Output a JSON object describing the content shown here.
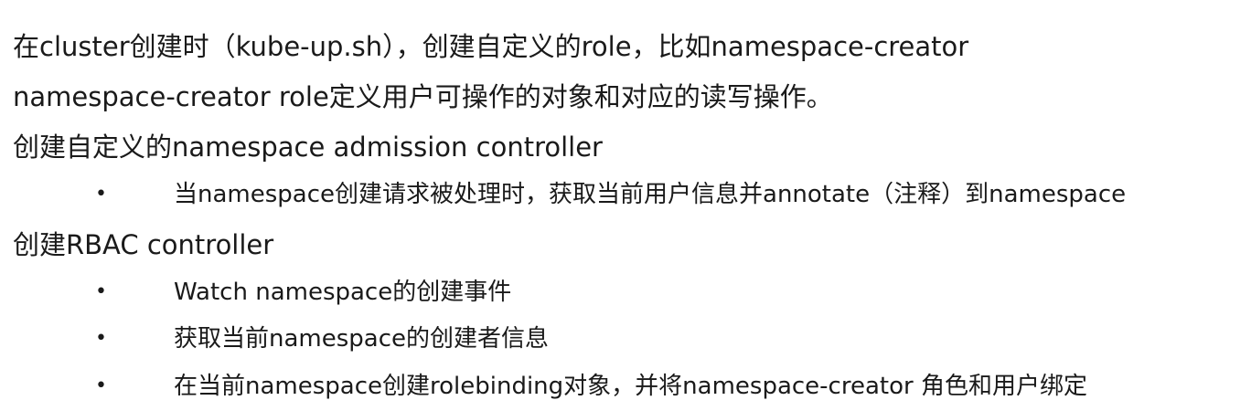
{
  "doc": {
    "line1": "在cluster创建时（kube-up.sh），创建自定义的role，比如namespace-creator",
    "line2": "namespace-creator role定义用户可操作的对象和对应的读写操作。",
    "line3": "创建自定义的namespace admission controller",
    "bullets_group1": [
      "当namespace创建请求被处理时，获取当前用户信息并annotate（注释）到namespace"
    ],
    "line4": "创建RBAC controller",
    "bullets_group2": [
      "Watch namespace的创建事件",
      "获取当前namespace的创建者信息",
      "在当前namespace创建rolebinding对象，并将namespace-creator 角色和用户绑定"
    ],
    "bullet_symbol": "•"
  }
}
